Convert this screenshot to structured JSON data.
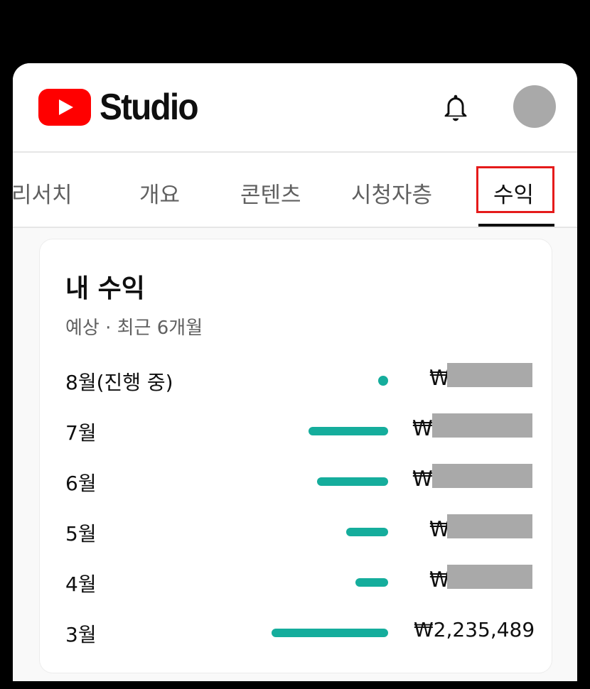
{
  "header": {
    "logo_text": "Studio",
    "icons": {
      "logo": "youtube-play-icon",
      "notifications": "bell-icon",
      "avatar": "avatar"
    }
  },
  "tabs": [
    {
      "label": "리서치",
      "active": false
    },
    {
      "label": "개요",
      "active": false
    },
    {
      "label": "콘텐츠",
      "active": false
    },
    {
      "label": "시청자층",
      "active": false
    },
    {
      "label": "수익",
      "active": true
    }
  ],
  "revenue": {
    "title": "내 수익",
    "subtitle": "예상 · 최근 6개월",
    "currency_symbol": "₩",
    "bar_color": "#15ad9c",
    "rows": [
      {
        "label": "8월(진행 중)",
        "bar_fraction": 0.03,
        "amount": null
      },
      {
        "label": "7월",
        "bar_fraction": 0.68,
        "amount": null
      },
      {
        "label": "6월",
        "bar_fraction": 0.61,
        "amount": null
      },
      {
        "label": "5월",
        "bar_fraction": 0.36,
        "amount": null
      },
      {
        "label": "4월",
        "bar_fraction": 0.28,
        "amount": null
      },
      {
        "label": "3월",
        "bar_fraction": 1.0,
        "amount": "₩2,235,489"
      }
    ]
  },
  "colors": {
    "brand_red": "#ff0000",
    "highlight_red": "#e51b1b",
    "avatar_gray": "#a9a9a9"
  }
}
